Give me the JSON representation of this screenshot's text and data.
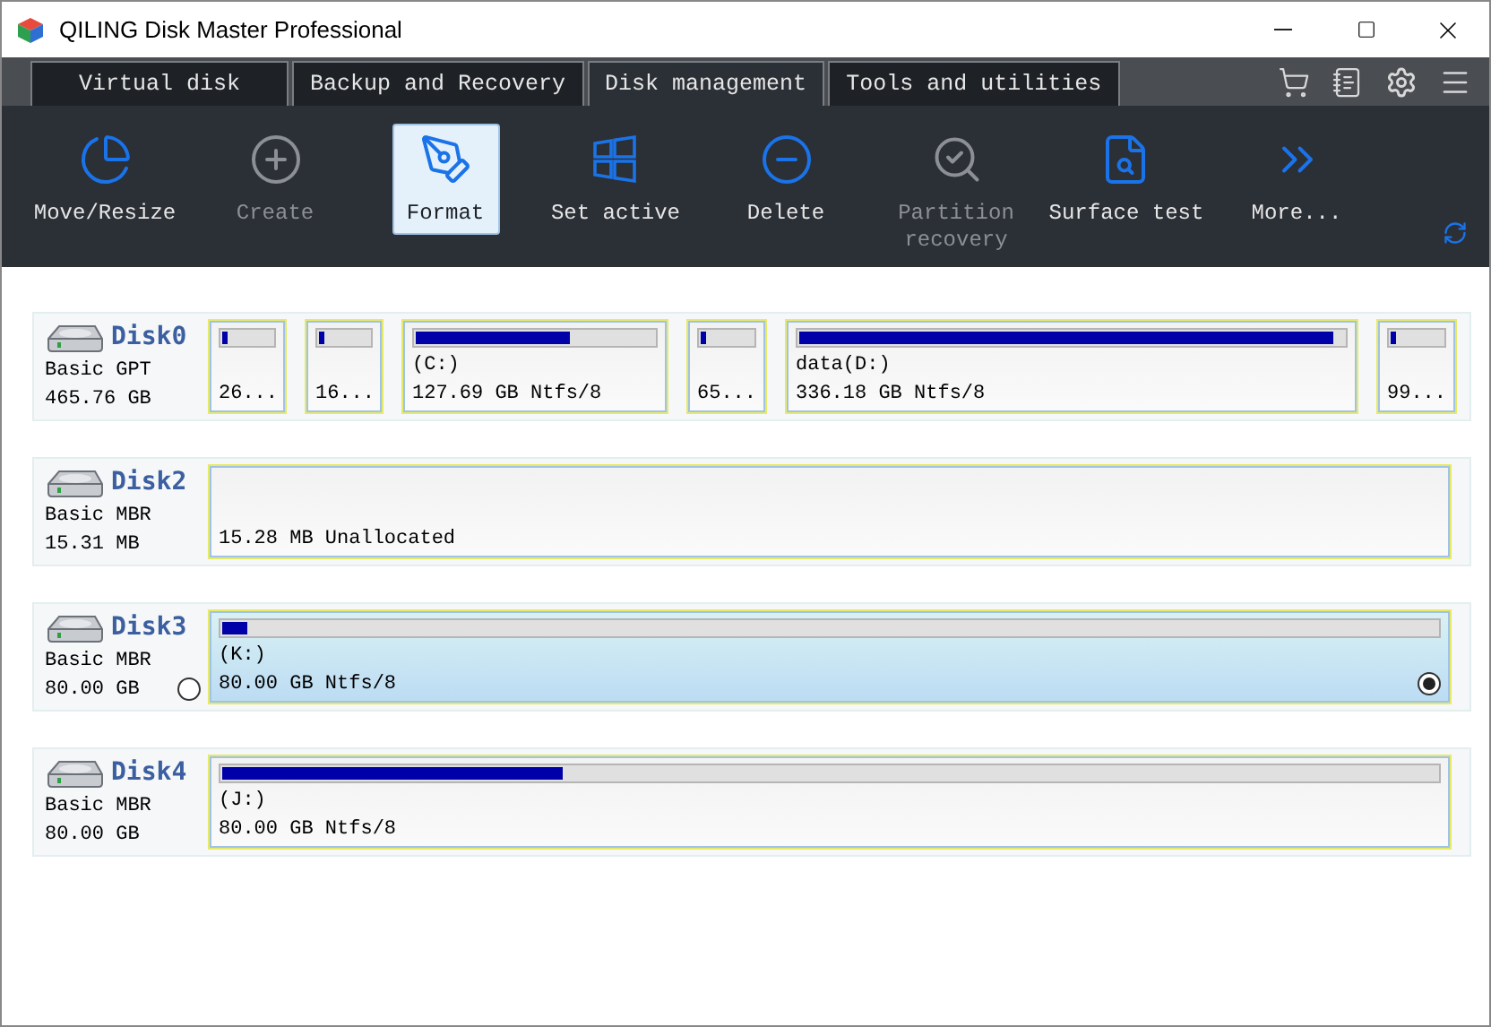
{
  "window": {
    "title": "QILING Disk Master Professional"
  },
  "tabs": [
    {
      "label": "Virtual disk",
      "selected": false
    },
    {
      "label": "Backup and Recovery",
      "selected": false
    },
    {
      "label": "Disk management",
      "selected": true
    },
    {
      "label": "Tools and utilities",
      "selected": false
    }
  ],
  "toolbar": [
    {
      "kind": "move",
      "label": "Move/Resize",
      "disabled": false,
      "selected": false
    },
    {
      "kind": "create",
      "label": "Create",
      "disabled": true,
      "selected": false
    },
    {
      "kind": "format",
      "label": "Format",
      "disabled": false,
      "selected": true
    },
    {
      "kind": "active",
      "label": "Set active",
      "disabled": false,
      "selected": false
    },
    {
      "kind": "delete",
      "label": "Delete",
      "disabled": false,
      "selected": false
    },
    {
      "kind": "recovery",
      "label": "Partition recovery",
      "disabled": true,
      "selected": false
    },
    {
      "kind": "surface",
      "label": "Surface test",
      "disabled": false,
      "selected": false
    },
    {
      "kind": "more",
      "label": "More...",
      "disabled": false,
      "selected": false
    }
  ],
  "disks": [
    {
      "name": "Disk0",
      "type": "Basic GPT",
      "size": "465.76 GB",
      "partitions": [
        {
          "kind": "used",
          "info": "26...",
          "level": 0.12,
          "selected": false
        },
        {
          "kind": "used",
          "info": "16...",
          "level": 0.12,
          "selected": false
        },
        {
          "kind": "used",
          "label": "(C:)",
          "info": "127.69 GB Ntfs/8",
          "level": 0.65,
          "selected": false
        },
        {
          "kind": "used",
          "info": "65...",
          "level": 0.12,
          "selected": false
        },
        {
          "kind": "used",
          "label": "data(D:)",
          "info": "336.18 GB Ntfs/8",
          "level": 0.98,
          "selected": false
        },
        {
          "kind": "used",
          "info": "99...",
          "level": 0.12,
          "selected": false
        }
      ]
    },
    {
      "name": "Disk2",
      "type": "Basic MBR",
      "size": "15.31 MB",
      "partitions": [
        {
          "kind": "unallocated",
          "info": "15.28 MB Unallocated",
          "selected": false
        }
      ]
    },
    {
      "name": "Disk3",
      "type": "Basic MBR",
      "size": "80.00 GB",
      "radio": {
        "selected": false
      },
      "partitions": [
        {
          "kind": "used",
          "label": "(K:)",
          "info": "80.00 GB Ntfs/8",
          "level": 0.02,
          "selected": true
        }
      ]
    },
    {
      "name": "Disk4",
      "type": "Basic MBR",
      "size": "80.00 GB",
      "partitions": [
        {
          "kind": "used",
          "label": "(J:)",
          "info": "80.00 GB Ntfs/8",
          "level": 0.28,
          "selected": false
        }
      ]
    }
  ]
}
